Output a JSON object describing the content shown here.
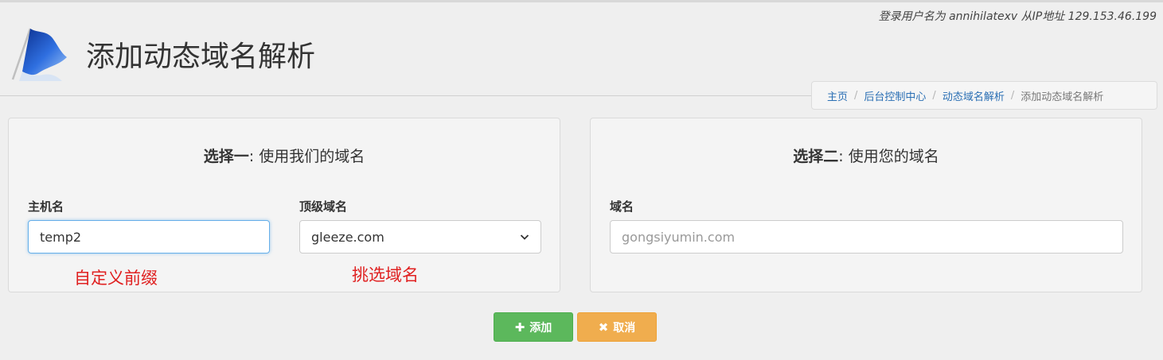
{
  "header": {
    "login_info": "登录用户名为 annihilatexv 从IP地址 129.153.46.199",
    "page_title": "添加动态域名解析"
  },
  "breadcrumb": {
    "items": [
      "主页",
      "后台控制中心",
      "动态域名解析"
    ],
    "active": "添加动态域名解析"
  },
  "option_one": {
    "heading_bold": "选择一",
    "heading_rest": ": 使用我们的域名",
    "hostname_label": "主机名",
    "hostname_value": "temp2",
    "tld_label": "顶级域名",
    "tld_selected": "gleeze.com",
    "annotation_hostname": "自定义前缀",
    "annotation_tld": "挑选域名"
  },
  "option_two": {
    "heading_bold": "选择二",
    "heading_rest": ": 使用您的域名",
    "domain_label": "域名",
    "domain_placeholder": "gongsiyumin.com"
  },
  "actions": {
    "add_glyph": "✚",
    "add_label": "添加",
    "cancel_glyph": "✖",
    "cancel_label": "取消"
  },
  "icons": {
    "logo": "blue-flag-icon",
    "select_arrow": "chevron-down-icon"
  },
  "colors": {
    "link": "#2a6fb4",
    "add_button": "#5cb85c",
    "cancel_button": "#f0ad4e",
    "annotation": "#e02020"
  }
}
